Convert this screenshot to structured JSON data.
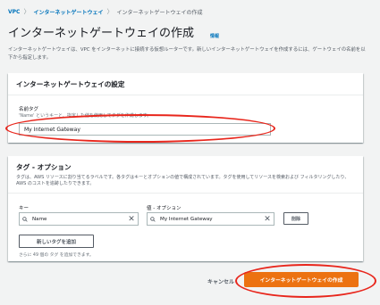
{
  "breadcrumb": {
    "items": [
      "VPC",
      "インターネットゲートウェイ"
    ],
    "current": "インターネットゲートウェイの作成",
    "separator": "〉"
  },
  "page": {
    "title": "インターネットゲートウェイの作成",
    "info_label": "情報",
    "description": "インターネットゲートウェイは、VPC をインターネットに接続する仮想ルーターです。新しいインターネットゲートウェイを作成するには、ゲートウェイの名前を以下から指定します。"
  },
  "settings": {
    "title": "インターネットゲートウェイの設定",
    "name_tag_label": "名前タグ",
    "name_tag_hint": "'Name' というキーと、指定した値を使用してタグを作成します。",
    "name_tag_value": "My Internet Gateway"
  },
  "tags": {
    "title": "タグ - オプション",
    "description": "タグは、AWS リソースに割り当てるラベルです。各タグはキーとオプションの値で構成されています。タグを使用してリソースを検索および フィルタリングしたり、AWS のコストを追跡したりできます。",
    "key_label": "キー",
    "value_label": "値 - オプション",
    "rows": [
      {
        "key": "Name",
        "value": "My Internet Gateway",
        "remove_label": "削除"
      }
    ],
    "add_button_label": "新しいタグを追加",
    "limit_note": "さらに 49 個の タグ を追加できます。"
  },
  "footer": {
    "cancel_label": "キャンセル",
    "create_label": "インターネットゲートウェイの作成"
  },
  "colors": {
    "link": "#0073bb",
    "primary_button": "#ec7211",
    "annotation": "#e8261c",
    "background": "#f2f3f3"
  }
}
